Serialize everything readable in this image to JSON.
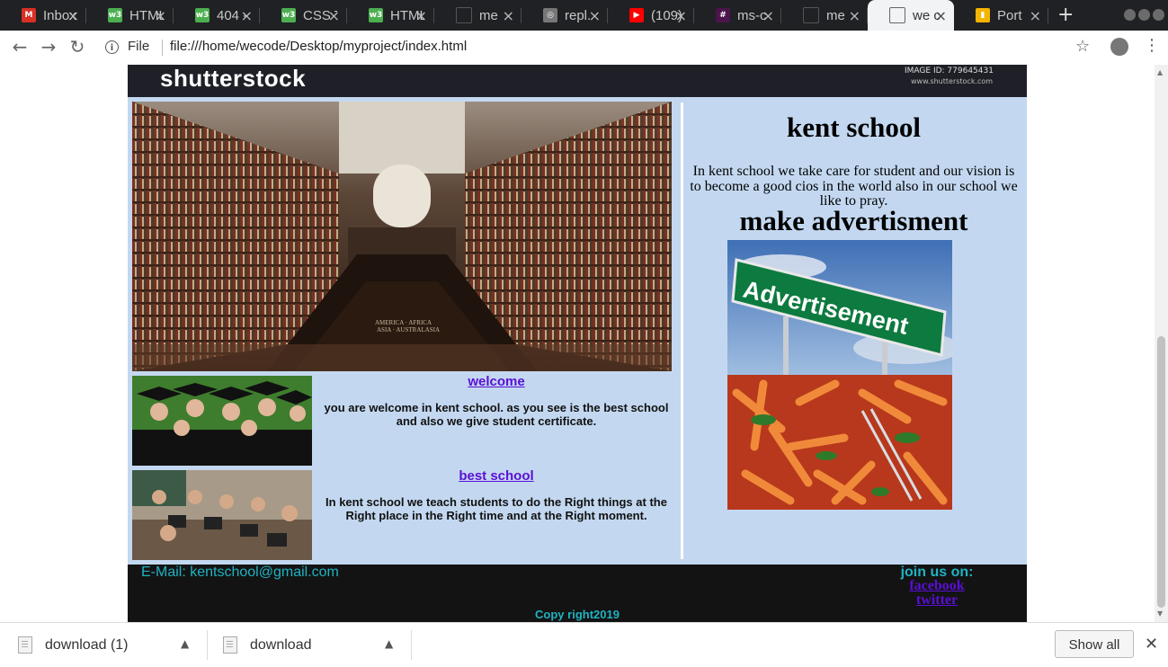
{
  "browser": {
    "tabs": [
      {
        "title": "Inbox",
        "icon": "gmail-icon",
        "color": "#d93025",
        "glyph": "M",
        "active": false
      },
      {
        "title": "HTML",
        "icon": "w3schools-icon",
        "color": "#4caf50",
        "glyph": "w3",
        "active": false
      },
      {
        "title": "404 -",
        "icon": "w3schools-icon",
        "color": "#4caf50",
        "glyph": "w3",
        "active": false
      },
      {
        "title": "CSS T",
        "icon": "w3schools-icon",
        "color": "#4caf50",
        "glyph": "w3",
        "active": false
      },
      {
        "title": "HTML",
        "icon": "w3schools-icon",
        "color": "#4caf50",
        "glyph": "w3",
        "active": false
      },
      {
        "title": "me",
        "icon": "page-icon",
        "color": "#444444",
        "glyph": "",
        "active": false
      },
      {
        "title": "repl.",
        "icon": "repl-icon",
        "color": "#777777",
        "glyph": "◎",
        "active": false
      },
      {
        "title": "(109)",
        "icon": "youtube-icon",
        "color": "#ff0000",
        "glyph": "▶",
        "active": false
      },
      {
        "title": "ms-c",
        "icon": "slack-icon",
        "color": "#4a154b",
        "glyph": "#",
        "active": false
      },
      {
        "title": "me",
        "icon": "page-icon",
        "color": "#444444",
        "glyph": "",
        "active": false
      },
      {
        "title": "we c",
        "icon": "page-icon",
        "color": "#ffffff",
        "glyph": "",
        "active": true
      },
      {
        "title": "Port",
        "icon": "chart-bar-icon",
        "color": "#f4b400",
        "glyph": "▮",
        "active": false
      }
    ],
    "new_tab_label": "+",
    "address": {
      "scheme_label": "File",
      "url": "file:///home/wecode/Desktop/myproject/index.html"
    }
  },
  "page": {
    "banner": {
      "logo": "shutterstock",
      "image_id": "IMAGE ID: 779645431",
      "site": "www.shutterstock.com"
    },
    "sections": [
      {
        "title": "welcome",
        "body": "you are welcome in kent school. as you see is the best school and also we give student certificate."
      },
      {
        "title": "best school",
        "body": "In kent school we teach students to do the Right things at the Right place in the Right time and at the Right moment."
      }
    ],
    "school_name": "kent school",
    "about": "In kent school we take care for student and our vision is to become a good cios in the world also in our school we like to pray.",
    "ad_title": "make advertisment",
    "ad_sign_text": "Advertisement",
    "library_sign": "AMERICA  AFRICA\nASIA  AUSTRALASIA",
    "footer": {
      "email": "E-Mail: kentschool@gmail.com",
      "join": "join us on:",
      "links": [
        "facebook",
        "twitter"
      ],
      "copyright": "Copy right2019"
    }
  },
  "downloads": {
    "items": [
      "download (1)",
      "download"
    ],
    "show_all": "Show all"
  }
}
